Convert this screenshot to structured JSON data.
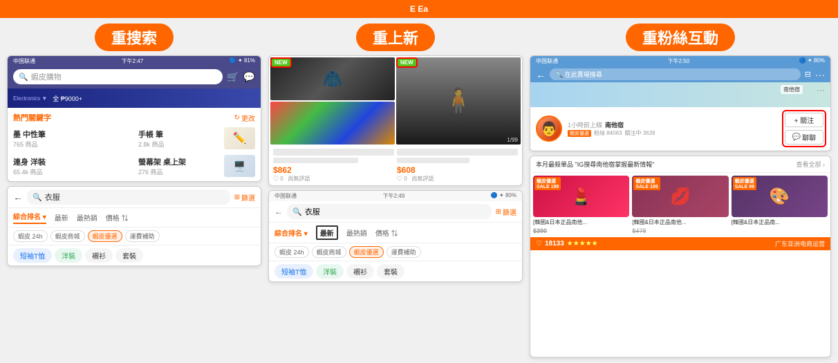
{
  "banner": {
    "text": "E Ea"
  },
  "sections": {
    "left": {
      "heading": "重搜索",
      "phone_status": {
        "carrier": "中国联通",
        "time": "下午2:47",
        "battery": "81%"
      },
      "search_placeholder": "蝦皮購物",
      "hot_keywords": {
        "title": "熱門關鍵字",
        "edit": "更改",
        "items": [
          {
            "name": "墨 中性筆",
            "count": "765 商品",
            "has_thumb": false
          },
          {
            "name": "手帳 筆",
            "count": "2.8k 商品",
            "has_thumb": true,
            "thumb_type": "pen"
          },
          {
            "name": "連身 洋裝",
            "count": "65.4k 商品",
            "has_thumb": false
          },
          {
            "name": "螢幕架 桌上架",
            "count": "276 商品",
            "has_thumb": true,
            "thumb_type": "desk"
          }
        ]
      },
      "search_screen": {
        "search_text": "衣服",
        "filter": "篩選",
        "sort_tabs": [
          "綜合排名",
          "最新",
          "最熱銷",
          "價格"
        ],
        "filter_tags": [
          "蝦皮 24h",
          "蝦皮商城",
          "蝦皮優選",
          "運費補助"
        ],
        "categories": [
          "短袖T恤",
          "洋裝",
          "襯衫",
          "套裝"
        ]
      }
    },
    "middle": {
      "heading": "重上新",
      "new_badge": "NEW",
      "products": [
        {
          "price": "$862",
          "rating": "0",
          "comment": "尚無評語"
        },
        {
          "price": "$608",
          "rating": "0",
          "comment": "尚無評語"
        }
      ],
      "phone2_status": {
        "carrier": "中国联通",
        "time": "下午2:49",
        "battery": "80%"
      },
      "phone2_search": "衣服",
      "phone2_filter": "篩選",
      "phone2_sort_tabs": [
        "綜合排名",
        "最新",
        "最熱銷",
        "價格"
      ],
      "phone2_filter_tags": [
        "蝦皮 24h",
        "蝦皮商城",
        "蝦皮優選",
        "運費補助"
      ],
      "phone2_categories": [
        "短袖T恤",
        "洋裝",
        "襯衫",
        "套裝"
      ],
      "highlight_tab": "最新"
    },
    "right": {
      "heading": "重粉絲互動",
      "seller_phone_status": {
        "carrier": "中国联通",
        "time": "下午2:50",
        "battery": "80%"
      },
      "store_search_placeholder": "在此賣場搜尋",
      "filter": "篩選",
      "seller": {
        "name": "南他宿",
        "time_online": "1小時前上線",
        "badge": "蝦皮優選",
        "followers": "粉絲 84063",
        "following": "關注中 3639",
        "follow_btn": "+ 關注",
        "chat_btn": "聊聊"
      },
      "products_section": {
        "title": "本月最殺單品 \"IG搜尋南他宿掌握最新情報\"",
        "view_all": "查看全部 ›",
        "products": [
          {
            "label": "SALE 199",
            "name": "[韓國&日本正品南他...",
            "price": "$390",
            "rating": "★★★★★"
          },
          {
            "label": "SALE 199",
            "name": "[韓國&日本正品南他...",
            "price": "$478",
            "rating": "★★★★★"
          },
          {
            "label": "SALE 99",
            "name": "[韓國&日本正品南...",
            "price": "",
            "rating": ""
          }
        ],
        "heart_count": "18133",
        "star_rating": "★★★★★"
      }
    }
  },
  "watermark": "广东亚洲电商运营"
}
